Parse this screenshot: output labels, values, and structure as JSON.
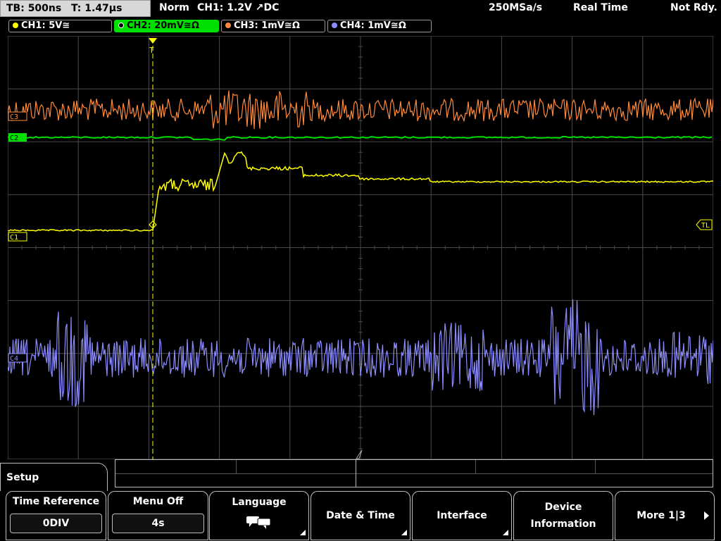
{
  "header": {
    "timebase": "TB: 500ns",
    "trigger_time": "T: 1.47µs",
    "trigger_mode": "Norm",
    "trigger_source": "CH1: 1.2V ↗DC",
    "sample_rate": "250MSa/s",
    "acq_mode": "Real Time",
    "status": "Not Rdy."
  },
  "channels": [
    {
      "label": "CH1: 5V≅",
      "color": "#ffff00",
      "active": false
    },
    {
      "label": "CH2: 20mV≅Ω",
      "color": "#00e000",
      "active": true
    },
    {
      "label": "CH3: 1mV≅Ω",
      "color": "#ff8a3c",
      "active": false
    },
    {
      "label": "CH4: 1mV≅Ω",
      "color": "#8c8cff",
      "active": false
    }
  ],
  "markers": {
    "ch1": "C1",
    "ch2": "C2",
    "ch3": "C3",
    "ch4": "C4",
    "trigger_level": "TL",
    "trigger_pos": "T"
  },
  "menu": {
    "title": "Setup",
    "softkeys": [
      {
        "label": "Time Reference",
        "value": "0DIV"
      },
      {
        "label": "Menu Off",
        "value": "4s"
      },
      {
        "label": "Language",
        "icon": "speech-bubbles-icon"
      },
      {
        "label": "Date & Time"
      },
      {
        "label": "Interface"
      },
      {
        "label_line1": "Device",
        "label_line2": "Information"
      },
      {
        "label": "More 1|3"
      }
    ]
  },
  "colors": {
    "ch1": "#ffff00",
    "ch2": "#00e000",
    "ch3": "#ff8a3c",
    "ch4": "#8c8cff",
    "grid": "#4a4a4a"
  }
}
